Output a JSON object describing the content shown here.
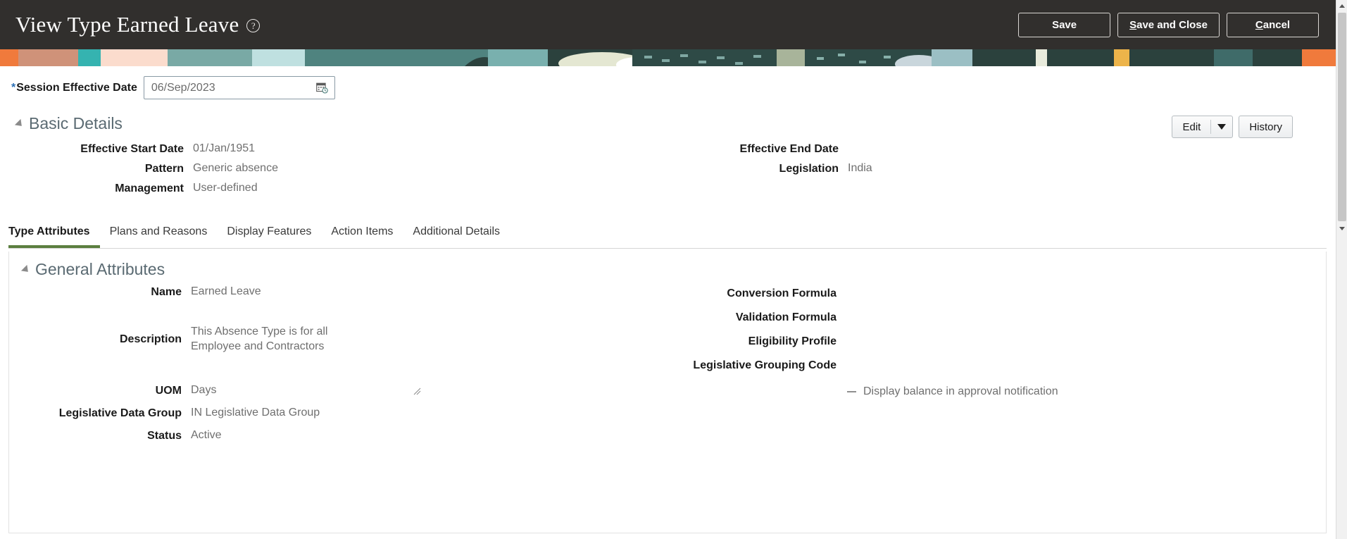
{
  "header": {
    "title": "View Type Earned Leave",
    "help_icon": "help-circle-icon",
    "buttons": [
      {
        "label": "Save",
        "accesskey": ""
      },
      {
        "label": "Save and Close",
        "accesskey": "S"
      },
      {
        "label": "Cancel",
        "accesskey": "C"
      }
    ]
  },
  "session": {
    "label": "Session Effective Date",
    "required_marker": "*",
    "value": "06/Sep/2023",
    "calendar_icon": "calendar-icon"
  },
  "basic_details": {
    "title": "Basic Details",
    "edit_label": "Edit",
    "edit_dropdown_icon": "chevron-down-icon",
    "history_label": "History",
    "left_fields": [
      {
        "label": "Effective Start Date",
        "value": "01/Jan/1951"
      },
      {
        "label": "Pattern",
        "value": "Generic absence"
      },
      {
        "label": "Management",
        "value": "User-defined"
      }
    ],
    "right_fields": [
      {
        "label": "Effective End Date",
        "value": ""
      },
      {
        "label": "Legislation",
        "value": "India"
      }
    ]
  },
  "tabs": [
    {
      "label": "Type Attributes",
      "active": true
    },
    {
      "label": "Plans and Reasons",
      "active": false
    },
    {
      "label": "Display Features",
      "active": false
    },
    {
      "label": "Action Items",
      "active": false
    },
    {
      "label": "Additional Details",
      "active": false
    }
  ],
  "general_attributes": {
    "title": "General Attributes",
    "left_fields": [
      {
        "label": "Name",
        "value": "Earned Leave"
      },
      {
        "label": "Description",
        "value": "This Absence Type is for all Employee and Contractors"
      },
      {
        "label": "UOM",
        "value": "Days"
      },
      {
        "label": "Legislative Data Group",
        "value": "IN Legislative Data Group"
      },
      {
        "label": "Status",
        "value": "Active"
      }
    ],
    "right_fields": [
      {
        "label": "Conversion Formula",
        "value": ""
      },
      {
        "label": "Validation Formula",
        "value": ""
      },
      {
        "label": "Eligibility Profile",
        "value": ""
      },
      {
        "label": "Legislative Grouping Code",
        "value": ""
      }
    ],
    "checkbox": {
      "label": "Display balance in approval notification",
      "state": "indeterminate"
    }
  },
  "scrollbar": {
    "up_icon": "scroll-up-arrow-icon",
    "down_icon": "scroll-down-arrow-icon"
  },
  "colors": {
    "header_bg": "#312f2d",
    "accent_tab": "#5b7f3f",
    "required_star": "#2b6fb5",
    "label_text": "#1a1a1a",
    "value_text": "#6f6f6f",
    "section_title": "#5a6a72"
  }
}
